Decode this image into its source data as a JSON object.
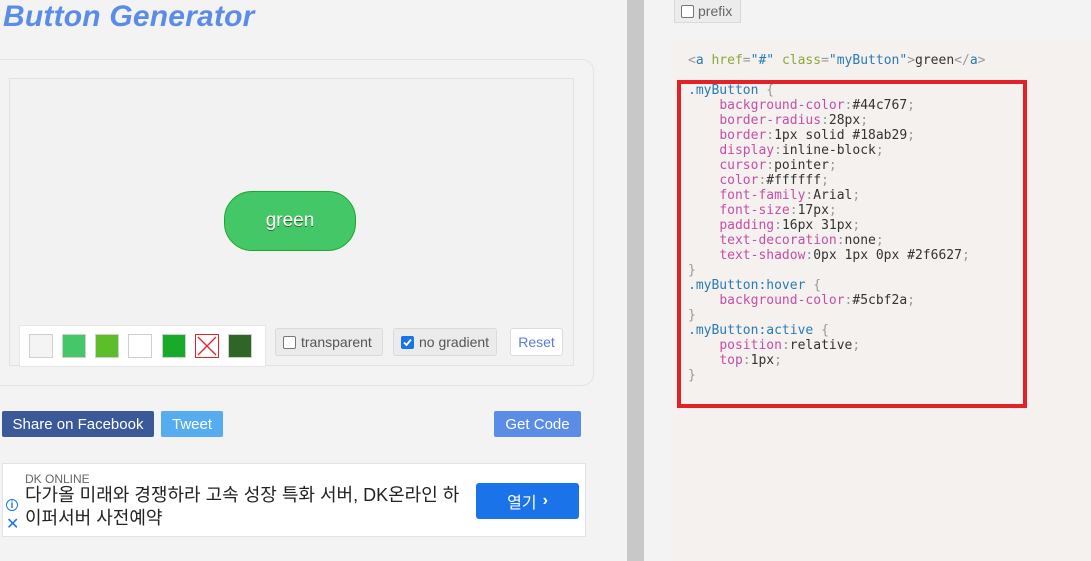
{
  "title": "Button Generator",
  "preview": {
    "button_label": "green",
    "bg": "#44c767",
    "border": "#18ab29"
  },
  "swatches": [
    {
      "color": "#f4f4f4",
      "label": "light"
    },
    {
      "color": "#44c767",
      "label": "green"
    },
    {
      "color": "#5cbf2a",
      "label": "lime"
    },
    {
      "color": "#ffffff",
      "label": "white"
    },
    {
      "color": "#18ab29",
      "label": "dark-green"
    },
    {
      "color": "none",
      "label": "none"
    },
    {
      "color": "#2f6627",
      "label": "forest"
    }
  ],
  "options": {
    "transparent_label": "transparent",
    "transparent_checked": false,
    "no_gradient_label": "no gradient",
    "no_gradient_checked": true,
    "reset_label": "Reset"
  },
  "share": {
    "facebook_label": "Share on Facebook",
    "tweet_label": "Tweet",
    "get_code_label": "Get Code"
  },
  "ad": {
    "source": "DK ONLINE",
    "text": "다가올 미래와 경쟁하라 고속 성장 특화 서버, DK온라인 하이퍼서버 사전예약",
    "button_label": "열기"
  },
  "prefix_label": "prefix",
  "html_snippet": {
    "open": "<a href=\"#\" class=\"myButton\">",
    "text": "green",
    "close": "</a>"
  },
  "css_rules": [
    {
      "selector": ".myButton",
      "props": [
        [
          "background-color",
          "#44c767"
        ],
        [
          "border-radius",
          "28px"
        ],
        [
          "border",
          "1px solid #18ab29"
        ],
        [
          "display",
          "inline-block"
        ],
        [
          "cursor",
          "pointer"
        ],
        [
          "color",
          "#ffffff"
        ],
        [
          "font-family",
          "Arial"
        ],
        [
          "font-size",
          "17px"
        ],
        [
          "padding",
          "16px 31px"
        ],
        [
          "text-decoration",
          "none"
        ],
        [
          "text-shadow",
          "0px 1px 0px #2f6627"
        ]
      ]
    },
    {
      "selector": ".myButton:hover",
      "props": [
        [
          "background-color",
          "#5cbf2a"
        ]
      ]
    },
    {
      "selector": ".myButton:active",
      "props": [
        [
          "position",
          "relative"
        ],
        [
          "top",
          "1px"
        ]
      ]
    }
  ],
  "colors": {
    "accent": "#5b8ce6",
    "highlight": "#e32128",
    "facebook": "#3b5998",
    "tweet": "#55acee",
    "get_code": "#5b8ce6"
  }
}
